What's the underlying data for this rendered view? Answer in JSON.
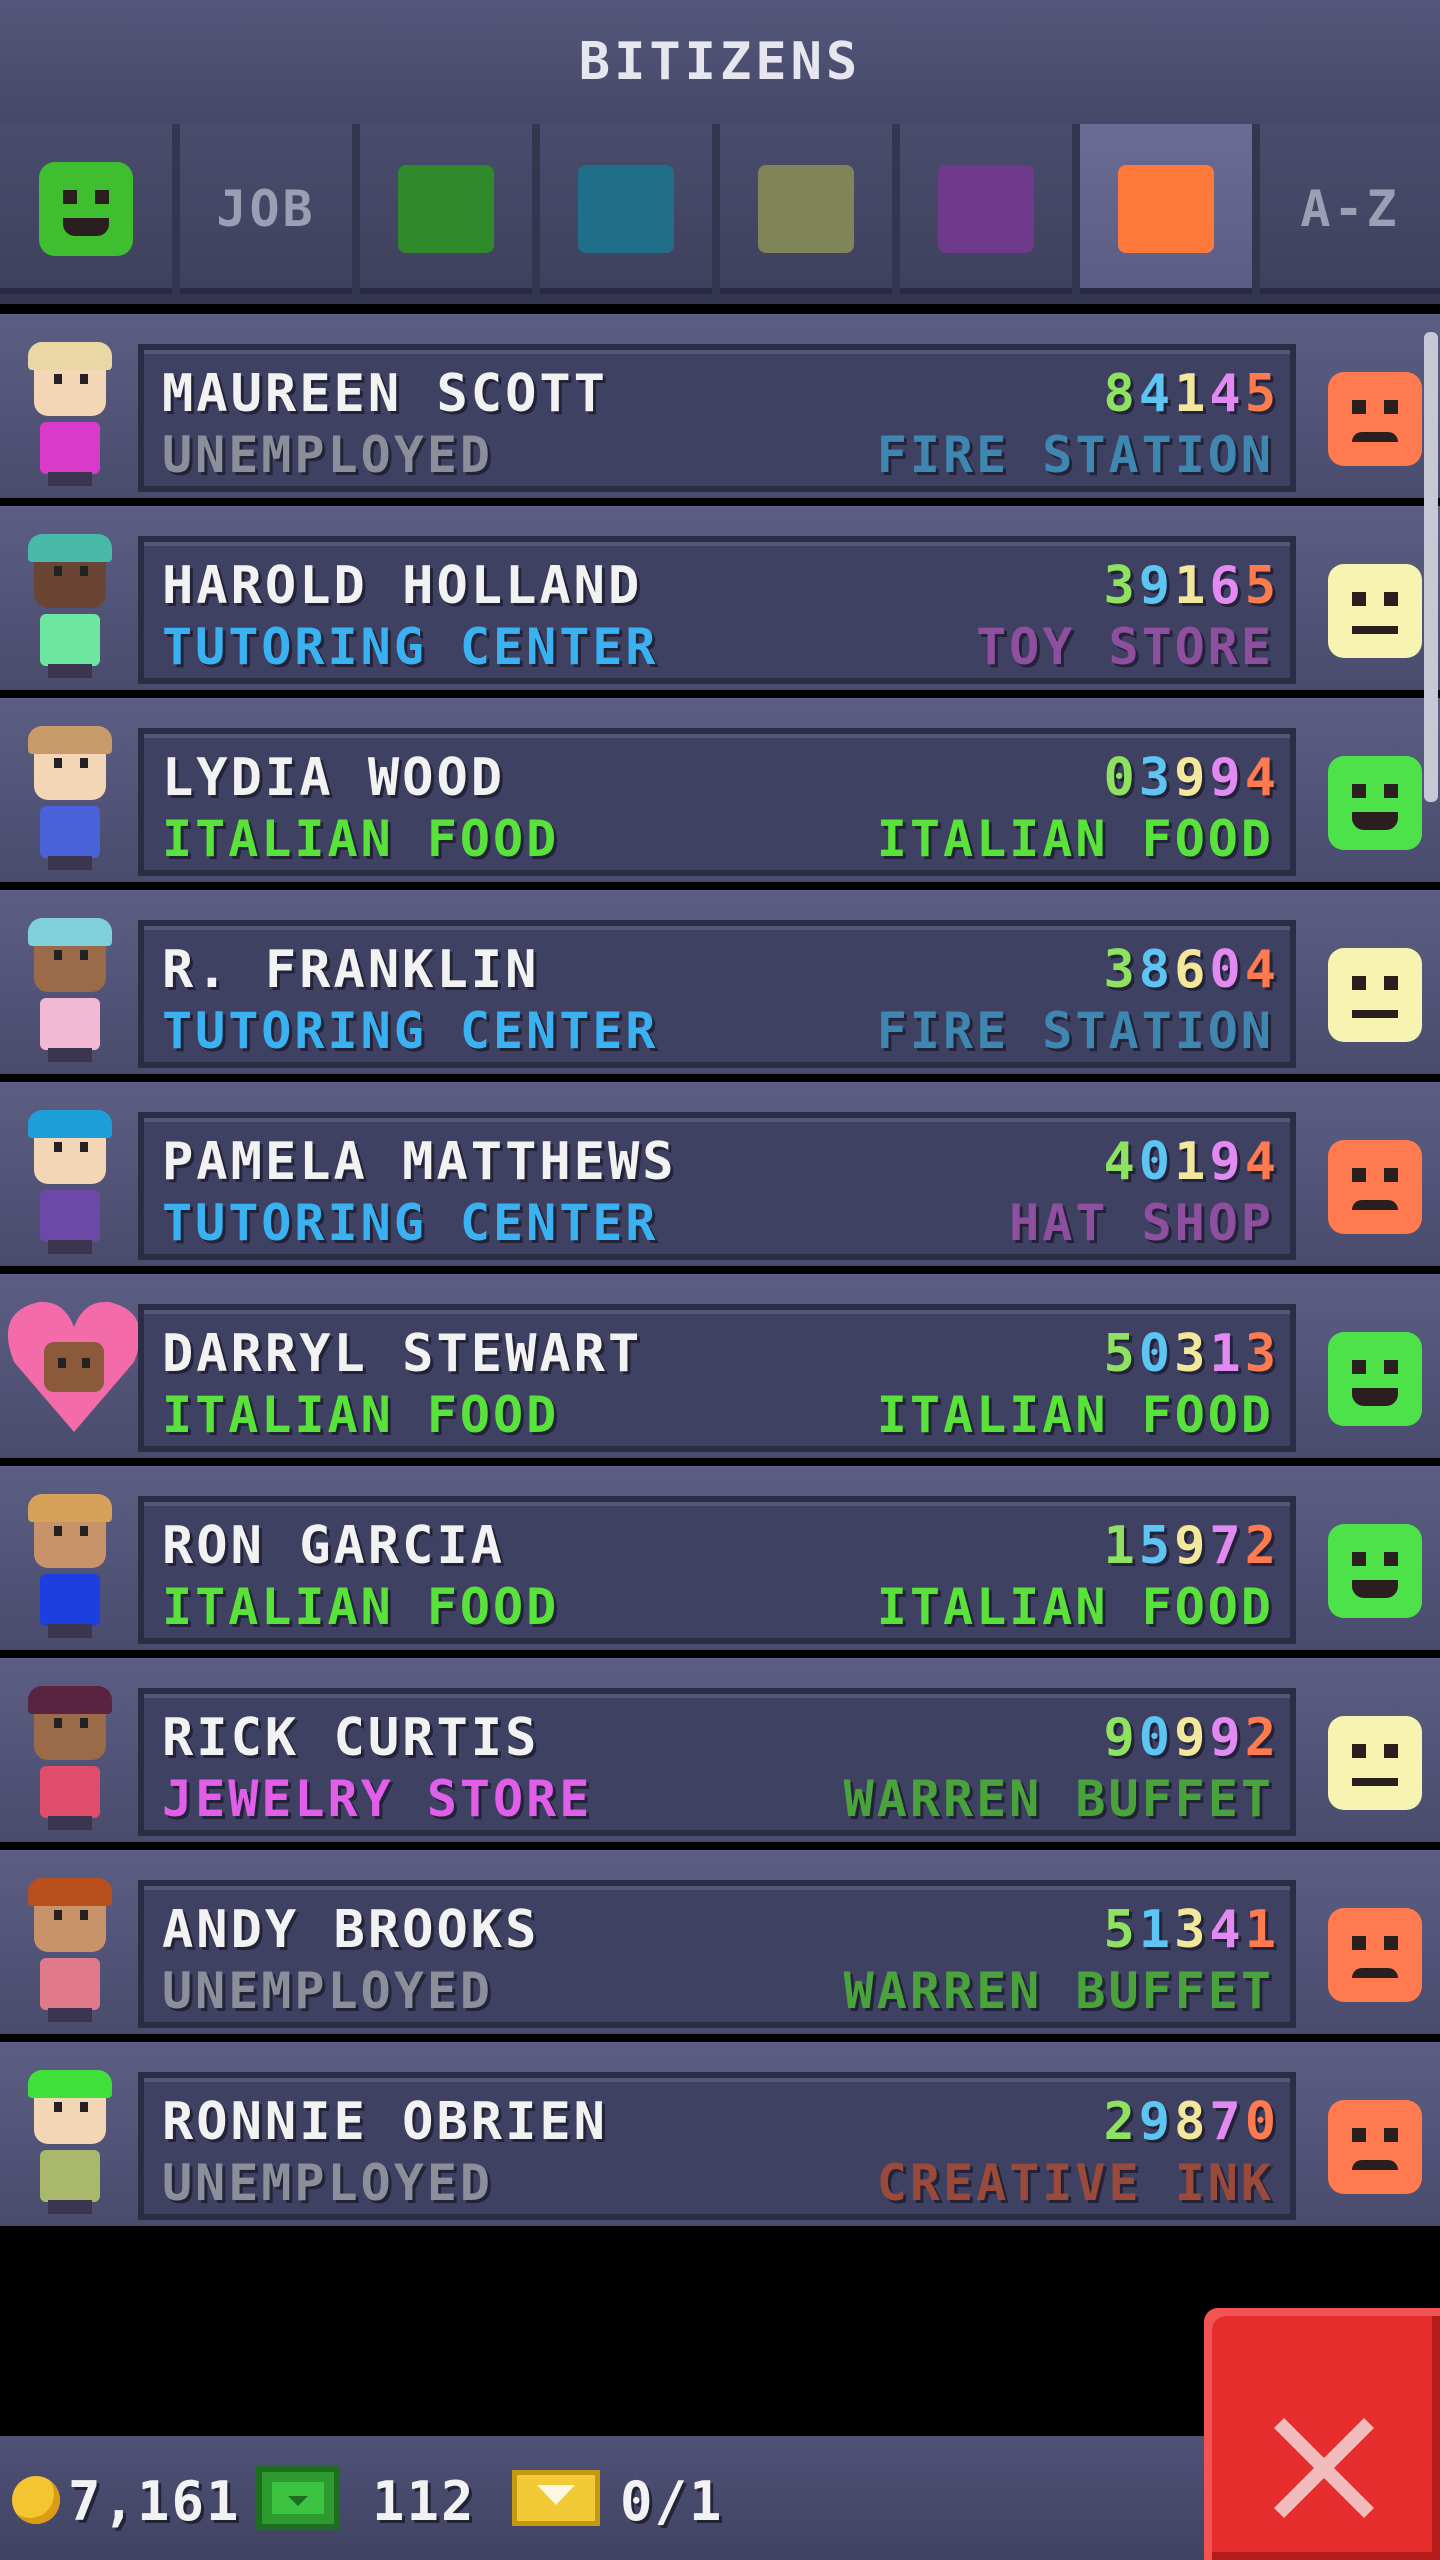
{
  "header": {
    "title": "BITIZENS"
  },
  "tabs": [
    {
      "type": "smiley",
      "icon": "green-smiley-icon",
      "color": "#3fbf2f"
    },
    {
      "type": "text",
      "label": "JOB"
    },
    {
      "type": "swatch",
      "icon": "color-swatch-icon",
      "color": "#2e8a2a"
    },
    {
      "type": "swatch",
      "icon": "color-swatch-icon",
      "color": "#1f6f8a"
    },
    {
      "type": "swatch",
      "icon": "color-swatch-icon",
      "color": "#7f8556"
    },
    {
      "type": "swatch",
      "icon": "color-swatch-icon",
      "color": "#6f3a8c"
    },
    {
      "type": "swatch",
      "icon": "color-swatch-icon",
      "color": "#ff7a3a",
      "selected": true
    },
    {
      "type": "text",
      "label": "A-Z"
    }
  ],
  "skill_colors": [
    "#8fe25f",
    "#5ec4f4",
    "#f2e79a",
    "#e38af2",
    "#ff7b4f"
  ],
  "bitizens": [
    {
      "name": "MAUREEN SCOTT",
      "job": "UNEMPLOYED",
      "job_color": "#8c8e99",
      "dream": "FIRE STATION",
      "dream_color": "#3f87b0",
      "skills": "84145",
      "mood": "sad",
      "hair": "#e9d7a4",
      "skin": "#f3d6b5",
      "shirt": "#d83ac9"
    },
    {
      "name": "HAROLD HOLLAND",
      "job": "TUTORING CENTER",
      "job_color": "#3ab2f2",
      "dream": "TOY STORE",
      "dream_color": "#8f4f9f",
      "skills": "39165",
      "mood": "neutral",
      "hair": "#48b9a8",
      "skin": "#6a4533",
      "shirt": "#6de6a0"
    },
    {
      "name": "LYDIA WOOD",
      "job": "ITALIAN FOOD",
      "job_color": "#58e23a",
      "dream": "ITALIAN FOOD",
      "dream_color": "#58e23a",
      "skills": "03994",
      "mood": "happy",
      "hair": "#c99a6a",
      "skin": "#f3d6b5",
      "shirt": "#4a62d8"
    },
    {
      "name": "R. FRANKLIN",
      "job": "TUTORING CENTER",
      "job_color": "#3ab2f2",
      "dream": "FIRE STATION",
      "dream_color": "#3f87b0",
      "skills": "38604",
      "mood": "neutral",
      "hair": "#7fd0d9",
      "skin": "#9b6a48",
      "shirt": "#f3b8d2"
    },
    {
      "name": "PAMELA MATTHEWS",
      "job": "TUTORING CENTER",
      "job_color": "#3ab2f2",
      "dream": "HAT SHOP",
      "dream_color": "#8f4f9f",
      "skills": "40194",
      "mood": "sad",
      "hair": "#1f9fd8",
      "skin": "#f3d6b5",
      "shirt": "#6c49a8"
    },
    {
      "name": "DARRYL STEWART",
      "job": "ITALIAN FOOD",
      "job_color": "#58e23a",
      "dream": "ITALIAN FOOD",
      "dream_color": "#58e23a",
      "skills": "50313",
      "mood": "happy",
      "heart": true,
      "hair": "#8a5a3a",
      "skin": "#8a5a3a",
      "shirt": "#ffffff"
    },
    {
      "name": "RON GARCIA",
      "job": "ITALIAN FOOD",
      "job_color": "#58e23a",
      "dream": "ITALIAN FOOD",
      "dream_color": "#58e23a",
      "skills": "15972",
      "mood": "happy",
      "hair": "#d6a25a",
      "skin": "#c9936a",
      "shirt": "#1d3ee0"
    },
    {
      "name": "RICK CURTIS",
      "job": "JEWELRY STORE",
      "job_color": "#e05ee8",
      "dream": "WARREN BUFFET",
      "dream_color": "#4aa33a",
      "skills": "90992",
      "mood": "neutral",
      "hair": "#5a2340",
      "skin": "#9b6a48",
      "shirt": "#e04c6a"
    },
    {
      "name": "ANDY BROOKS",
      "job": "UNEMPLOYED",
      "job_color": "#8c8e99",
      "dream": "WARREN BUFFET",
      "dream_color": "#4aa33a",
      "skills": "51341",
      "mood": "sad",
      "hair": "#b84f1c",
      "skin": "#c9936a",
      "shirt": "#e07a8a"
    },
    {
      "name": "RONNIE OBRIEN",
      "job": "UNEMPLOYED",
      "job_color": "#8c8e99",
      "dream": "CREATIVE INK",
      "dream_color": "#9a4a3a",
      "skills": "29870",
      "mood": "sad",
      "hair": "#3fe03a",
      "skin": "#f3d6b5",
      "shirt": "#a9b86a"
    }
  ],
  "mood_colors": {
    "happy": "#4ee24a",
    "neutral": "#f7f3b0",
    "sad": "#ff7a4f"
  },
  "resources": {
    "coins": "7,161",
    "bux": "112",
    "tickets": "0/1"
  },
  "close": {
    "icon": "close-icon"
  }
}
